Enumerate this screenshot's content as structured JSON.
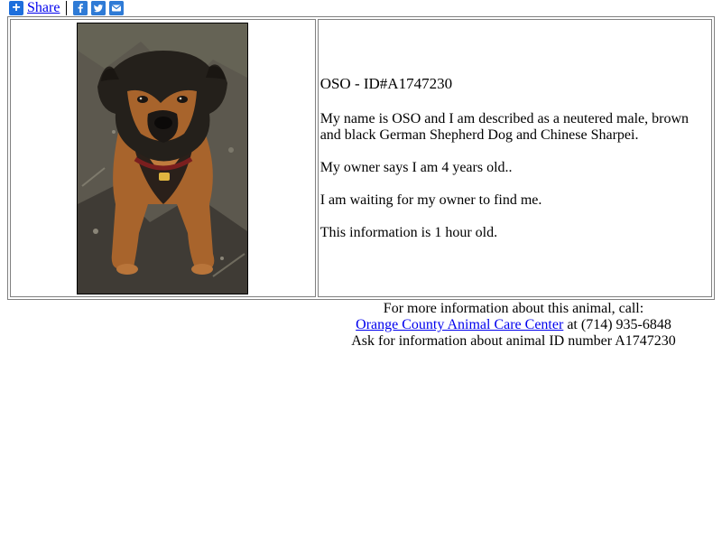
{
  "share": {
    "label": "Share",
    "icons": [
      "plus-icon",
      "facebook-icon",
      "twitter-icon",
      "email-icon"
    ]
  },
  "animal": {
    "title": "OSO - ID#A1747230",
    "description": "My name is OSO and I am described as a neutered male, brown and black German Shepherd Dog and Chinese Sharpei.",
    "age_text": "My owner says I am 4 years old..",
    "status_text": "I am waiting for my owner to find me.",
    "freshness_text": "This information is 1 hour old."
  },
  "footer": {
    "line1": "For more information about this animal, call:",
    "agency_link": "Orange County Animal Care Center",
    "phone_text": " at (714) 935-6848",
    "line3": "Ask for information about animal ID number A1747230"
  },
  "colors": {
    "link": "#0000ee",
    "share_icon": "#1e6fdc",
    "border": "#808080"
  }
}
